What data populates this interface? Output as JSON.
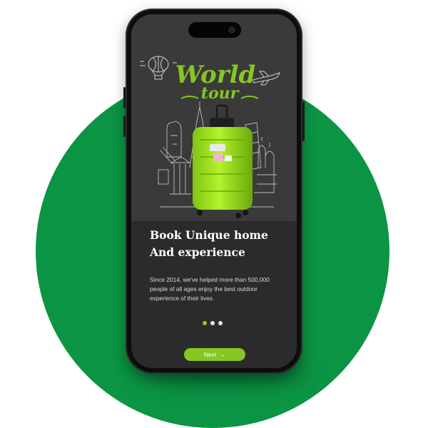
{
  "hero": {
    "logo_line1": "World",
    "logo_line2": "tour",
    "accent_color": "#86c623",
    "suitcase_color": "#a4e81e"
  },
  "onboarding": {
    "title": "Book Unique home\nAnd experience",
    "description": "Since 2014, we've helped more than 500,000 people of all ages enjoy the best outdoor experience of their lives.",
    "page_indicator": {
      "total": 3,
      "active": 1
    },
    "next_label": "Next",
    "next_icon": "arrow-right-icon"
  },
  "colors": {
    "background_circle": "#0b9444",
    "screen": "#2b2b2b",
    "button": "#86c623"
  }
}
